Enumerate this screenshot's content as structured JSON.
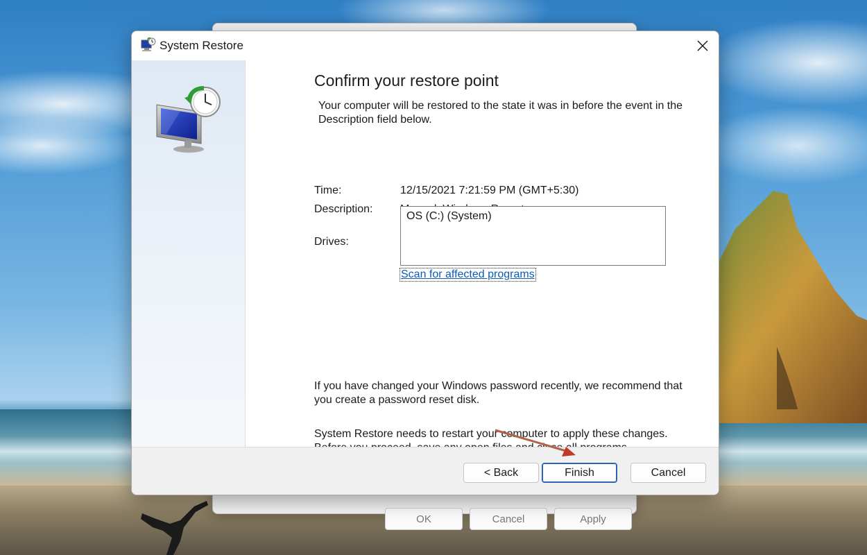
{
  "background_window": {
    "buttons": [
      "OK",
      "Cancel",
      "Apply"
    ]
  },
  "dialog": {
    "title": "System Restore",
    "heading": "Confirm your restore point",
    "intro": "Your computer will be restored to the state it was in before the event in the Description field below.",
    "time_label": "Time:",
    "time_value": "12/15/2021 7:21:59 PM (GMT+5:30)",
    "description_label": "Description:",
    "description_value": "Manual: Windows Report",
    "drives_label": "Drives:",
    "drives": [
      "OS (C:) (System)"
    ],
    "scan_link": "Scan for affected programs",
    "password_note": "If you have changed your Windows password recently, we recommend that you create a password reset disk.",
    "restart_note": "System Restore needs to restart your computer to apply these changes. Before you proceed, save any open files and close all programs.",
    "buttons": {
      "back": "< Back",
      "finish": "Finish",
      "cancel": "Cancel"
    },
    "icons": {
      "title": "system-restore-icon",
      "close": "close-icon",
      "main": "restore-computer-icon",
      "annotation": "arrow-annotation"
    },
    "colors": {
      "link": "#0b5bb5",
      "primary_border": "#2a64b8",
      "annotation_arrow": "#b0624a"
    }
  }
}
